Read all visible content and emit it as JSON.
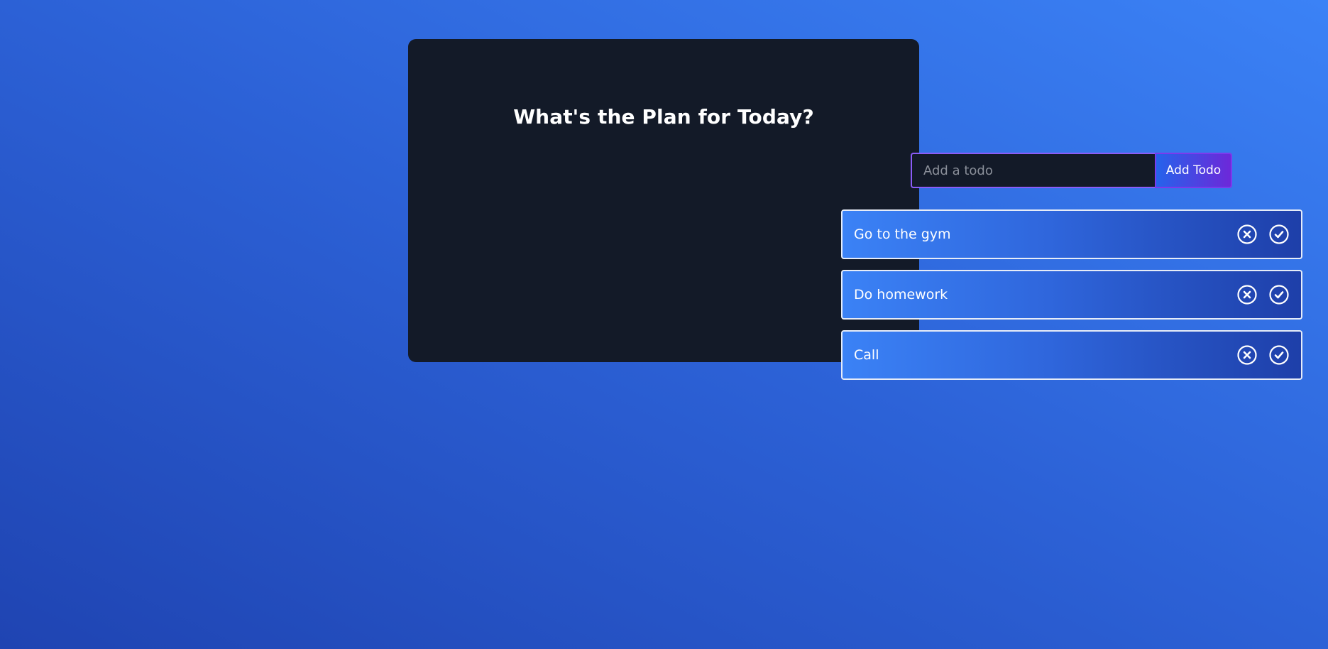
{
  "app": {
    "title": "What's the Plan for Today?"
  },
  "form": {
    "input_placeholder": "Add a todo",
    "input_value": "",
    "add_label": "Add Todo"
  },
  "todos": [
    {
      "text": "Go to the gym",
      "remove_icon": "close-circle-icon",
      "edit_icon": "check-circle-icon"
    },
    {
      "text": "Do homework",
      "remove_icon": "close-circle-icon",
      "edit_icon": "check-circle-icon"
    },
    {
      "text": "Call",
      "remove_icon": "close-circle-icon",
      "edit_icon": "check-circle-icon"
    }
  ],
  "colors": {
    "card_bg": "#131a28",
    "accent": "#8b5cf6",
    "row_gradient_start": "#3b82f6",
    "row_gradient_end": "#1e3fa9"
  }
}
